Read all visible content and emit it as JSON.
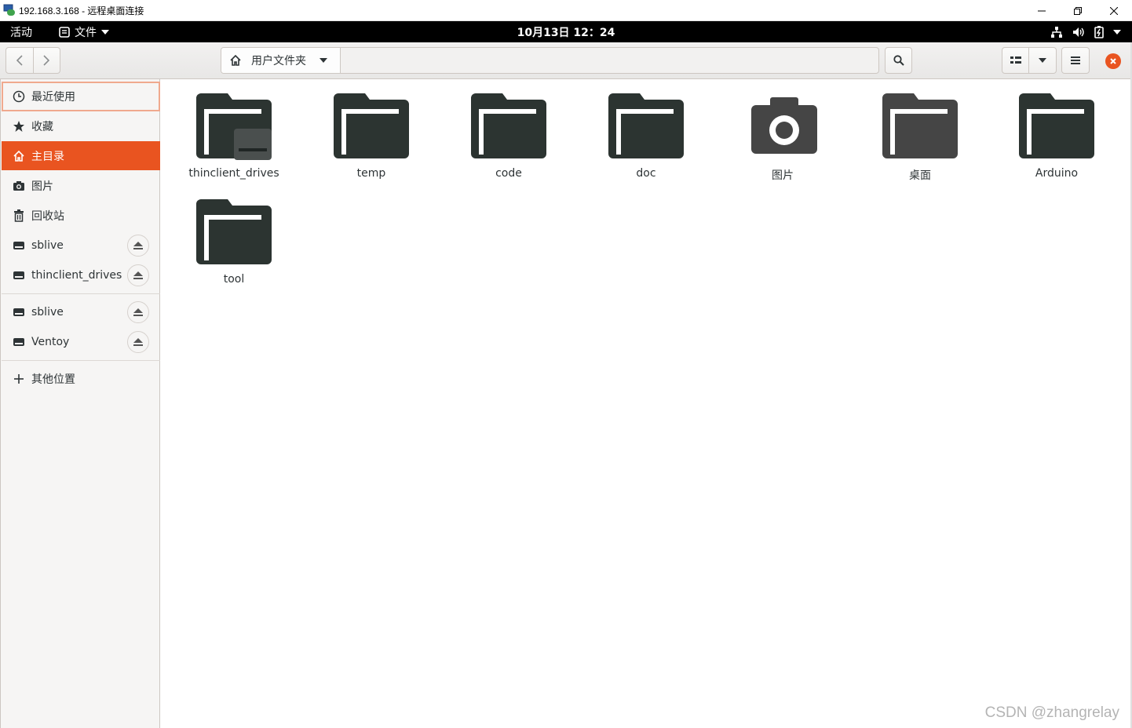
{
  "window": {
    "title": "192.168.3.168 - 远程桌面连接"
  },
  "topbar": {
    "activities": "活动",
    "app_menu": "文件",
    "clock": "10月13日 12：24"
  },
  "headerbar": {
    "location": "用户文件夹"
  },
  "sidebar": {
    "places": [
      {
        "label": "最近使用",
        "icon": "clock-icon"
      },
      {
        "label": "收藏",
        "icon": "star-icon"
      },
      {
        "label": "主目录",
        "icon": "home-icon"
      },
      {
        "label": "图片",
        "icon": "camera-icon"
      },
      {
        "label": "回收站",
        "icon": "trash-icon"
      }
    ],
    "mounts": [
      {
        "label": "sblive",
        "icon": "drive-icon"
      },
      {
        "label": "thinclient_drives",
        "icon": "drive-icon"
      }
    ],
    "devices": [
      {
        "label": "sblive",
        "icon": "drive-icon"
      },
      {
        "label": "Ventoy",
        "icon": "drive-icon"
      }
    ],
    "other": {
      "label": "其他位置",
      "icon": "plus-icon"
    }
  },
  "files": [
    {
      "name": "thinclient_drives",
      "icon": "folder-remote-icon"
    },
    {
      "name": "temp",
      "icon": "folder-icon"
    },
    {
      "name": "code",
      "icon": "folder-icon"
    },
    {
      "name": "doc",
      "icon": "folder-icon"
    },
    {
      "name": "图片",
      "icon": "folder-pictures-icon"
    },
    {
      "name": "桌面",
      "icon": "folder-desktop-icon"
    },
    {
      "name": "Arduino",
      "icon": "folder-icon"
    },
    {
      "name": "tool",
      "icon": "folder-icon"
    }
  ],
  "watermark": "CSDN @zhangrelay",
  "colors": {
    "accent": "#e95420",
    "folder": "#2c3431",
    "folder_desktop": "#454545",
    "topbar": "#000000"
  }
}
